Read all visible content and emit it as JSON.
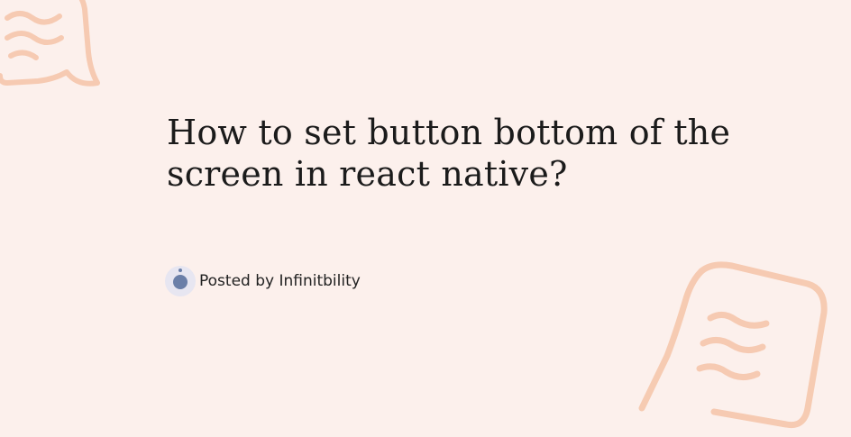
{
  "article": {
    "title": "How to set button bottom of the screen in react native?",
    "author_line": "Posted by Infinitbility"
  },
  "colors": {
    "background": "#fcf0ec",
    "decoration": "#f5c4a8",
    "title_text": "#1b1b1b",
    "avatar": "#6b7fa8"
  },
  "icons": {
    "top_left_decoration": "speech-bubble-doodle-icon",
    "bottom_right_decoration": "note-doodle-icon",
    "author_avatar": "avatar-icon"
  }
}
